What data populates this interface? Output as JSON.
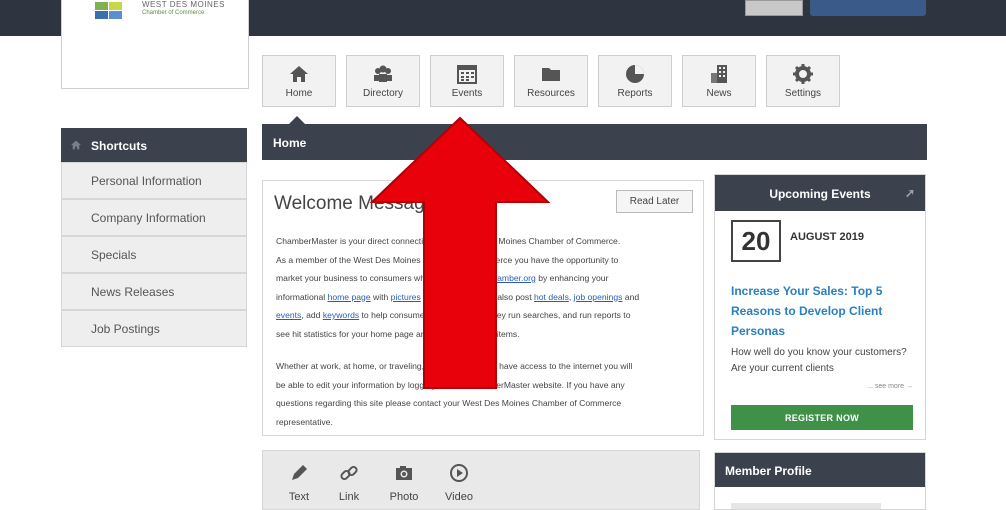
{
  "header": {
    "logo_line1": "WEST DES MOINES",
    "logo_line2": "Chamber of Commerce",
    "colors": {
      "topbar": "#2e3440",
      "accent_blue": "#3a5a8a"
    }
  },
  "nav_tiles": [
    {
      "label": "Home",
      "icon": "home-icon"
    },
    {
      "label": "Directory",
      "icon": "users-icon"
    },
    {
      "label": "Events",
      "icon": "calendar-icon"
    },
    {
      "label": "Resources",
      "icon": "folder-icon"
    },
    {
      "label": "Reports",
      "icon": "pie-chart-icon"
    },
    {
      "label": "News",
      "icon": "building-icon"
    },
    {
      "label": "Settings",
      "icon": "gear-icon"
    }
  ],
  "sidebar": {
    "title": "Shortcuts",
    "items": [
      {
        "label": "Personal Information"
      },
      {
        "label": "Company Information"
      },
      {
        "label": "Specials"
      },
      {
        "label": "News Releases"
      },
      {
        "label": "Job Postings"
      }
    ]
  },
  "main": {
    "section_title": "Home",
    "welcome": {
      "title": "Welcome Message",
      "read_later": "Read Later",
      "p1_a": "ChamberMaster is your direct connection to the West Des Moines Chamber of Commerce.",
      "p1_b": "As a member of the West Des Moines Chamber of Commerce you have the opportunity to",
      "p1_c": "market your business to consumers who visit ",
      "p1_link1": "www.wdmchamber.org",
      "p1_d": " by enhancing your",
      "p1_e": "informational ",
      "p1_link2": "home page",
      "p1_f": " with ",
      "p1_link3": "pictures",
      "p1_g": " and more. You can also post ",
      "p1_link4": "hot deals",
      "p1_h": ", ",
      "p1_link5": "job openings",
      "p1_i": " and",
      "p1_link6": "events",
      "p1_j": ", add ",
      "p1_link7": "keywords",
      "p1_k": " to help consumers find you when they run searches, and run reports to",
      "p1_l": "see hit statistics for your home page and other advertised items.",
      "p2_a": "Whether at work, at home, or traveling, anywhere that you have access to the internet you will",
      "p2_b": "be able to edit your information by logging into the ChamberMaster website.  If you have any",
      "p2_c": "questions regarding this site please contact your West Des Moines Chamber of Commerce",
      "p2_d": "representative."
    },
    "post_actions": [
      {
        "label": "Text",
        "icon": "pencil-icon"
      },
      {
        "label": "Link",
        "icon": "link-icon"
      },
      {
        "label": "Photo",
        "icon": "camera-icon"
      },
      {
        "label": "Video",
        "icon": "play-icon"
      }
    ]
  },
  "events": {
    "title": "Upcoming Events",
    "day": "20",
    "month": "AUGUST 2019",
    "event_title": "Increase Your Sales: Top 5 Reasons to Develop Client Personas",
    "event_desc": "How well do you know your customers? Are your current clients",
    "see_more": "... see more →",
    "register": "REGISTER NOW",
    "colors": {
      "title_link": "#2a7fbf",
      "register_bg": "#3f9148"
    }
  },
  "member_profile": {
    "title": "Member Profile"
  },
  "overlay": {
    "arrow_color": "#e8000b"
  }
}
